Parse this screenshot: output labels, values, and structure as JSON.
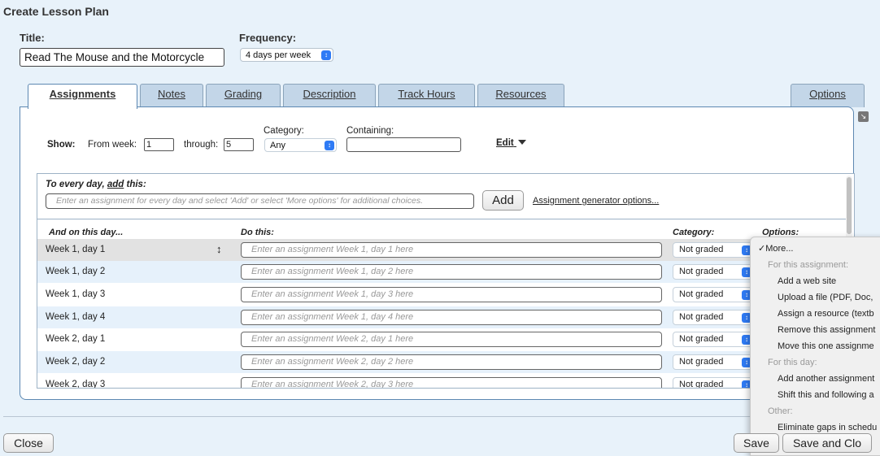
{
  "page_title": "Create Lesson Plan",
  "title": {
    "label": "Title:",
    "value": "Read The Mouse and the Motorcycle"
  },
  "frequency": {
    "label": "Frequency:",
    "value": "4 days per week"
  },
  "tabs": [
    {
      "label": "Assignments"
    },
    {
      "label": "Notes"
    },
    {
      "label": "Grading"
    },
    {
      "label": "Description"
    },
    {
      "label": "Track Hours"
    },
    {
      "label": "Resources"
    },
    {
      "label": "Options"
    }
  ],
  "filters": {
    "show_label": "Show:",
    "from_label": "From week:",
    "from_value": "1",
    "through_label": "through:",
    "through_value": "5",
    "category_label": "Category:",
    "category_value": "Any",
    "containing_label": "Containing:",
    "containing_value": "",
    "edit_label": "Edit"
  },
  "every_day": {
    "label_prefix": "To every day, ",
    "label_add": "add",
    "label_suffix": " this:",
    "placeholder": "Enter an assignment for every day and select 'Add' or select 'More options' for additional choices.",
    "add_button": "Add",
    "generator_link": "Assignment generator options..."
  },
  "columns": {
    "day": "And on this day...",
    "do": "Do this:",
    "category": "Category:",
    "options": "Options:"
  },
  "rows": [
    {
      "day": "Week 1, day 1",
      "placeholder": "Enter an assignment Week 1, day 1 here",
      "category": "Not graded"
    },
    {
      "day": "Week 1, day 2",
      "placeholder": "Enter an assignment Week 1, day 2 here",
      "category": "Not graded"
    },
    {
      "day": "Week 1, day 3",
      "placeholder": "Enter an assignment Week 1, day 3 here",
      "category": "Not graded"
    },
    {
      "day": "Week 1, day 4",
      "placeholder": "Enter an assignment Week 1, day 4 here",
      "category": "Not graded"
    },
    {
      "day": "Week 2, day 1",
      "placeholder": "Enter an assignment Week 2, day 1 here",
      "category": "Not graded"
    },
    {
      "day": "Week 2, day 2",
      "placeholder": "Enter an assignment Week 2, day 2 here",
      "category": "Not graded"
    },
    {
      "day": "Week 2, day 3",
      "placeholder": "Enter an assignment Week 2, day 3 here",
      "category": "Not graded"
    }
  ],
  "options_menu": {
    "selected": "More...",
    "items": [
      {
        "text": "For this assignment:",
        "header": true
      },
      {
        "text": "Add a web site",
        "header": false
      },
      {
        "text": "Upload a file (PDF, Doc,",
        "header": false
      },
      {
        "text": "Assign a resource (textb",
        "header": false
      },
      {
        "text": "Remove this assignment",
        "header": false
      },
      {
        "text": "Move this one assignme",
        "header": false
      },
      {
        "text": "For this day:",
        "header": true
      },
      {
        "text": "Add another assignment",
        "header": false
      },
      {
        "text": "Shift this and following a",
        "header": false
      },
      {
        "text": "Other:",
        "header": true
      },
      {
        "text": "Eliminate gaps in schedu",
        "header": false
      }
    ]
  },
  "footer": {
    "close": "Close",
    "save": "Save",
    "save_close": "Save and Clo"
  },
  "colors": {
    "background": "#e8f2fa",
    "tab_inactive": "#c3d6e8",
    "panel_border": "#5d88b2",
    "row_alt": "#e6f1fb",
    "accent_blue": "#2f7bf5"
  }
}
